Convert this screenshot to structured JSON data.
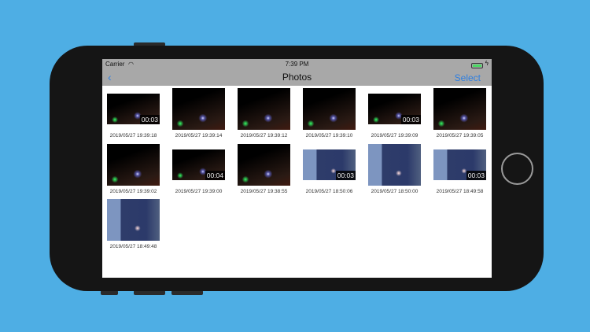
{
  "status_bar": {
    "carrier": "Carrier",
    "time": "7:39 PM"
  },
  "nav": {
    "title": "Photos",
    "select_label": "Select",
    "back_label": "‹"
  },
  "items": [
    {
      "date": "2019/05/27 19:39:18",
      "duration": "00:03",
      "kind": "video",
      "tone": "night"
    },
    {
      "date": "2019/05/27 19:39:14",
      "duration": null,
      "kind": "photo",
      "tone": "night"
    },
    {
      "date": "2019/05/27 19:39:12",
      "duration": null,
      "kind": "photo",
      "tone": "night"
    },
    {
      "date": "2019/05/27 19:39:10",
      "duration": null,
      "kind": "photo",
      "tone": "night"
    },
    {
      "date": "2019/05/27 19:39:09",
      "duration": "00:03",
      "kind": "video",
      "tone": "night"
    },
    {
      "date": "2019/05/27 19:39:05",
      "duration": null,
      "kind": "photo",
      "tone": "night"
    },
    {
      "date": "2019/05/27 19:39:02",
      "duration": null,
      "kind": "photo",
      "tone": "night"
    },
    {
      "date": "2019/05/27 19:39:00",
      "duration": "00:04",
      "kind": "video",
      "tone": "night"
    },
    {
      "date": "2019/05/27 19:38:55",
      "duration": null,
      "kind": "photo",
      "tone": "night"
    },
    {
      "date": "2019/05/27 18:50:06",
      "duration": "00:03",
      "kind": "video",
      "tone": "day"
    },
    {
      "date": "2019/05/27 18:50:00",
      "duration": null,
      "kind": "photo",
      "tone": "day"
    },
    {
      "date": "2019/05/27 18:49:58",
      "duration": "00:03",
      "kind": "video",
      "tone": "day"
    },
    {
      "date": "2019/05/27 18:49:48",
      "duration": null,
      "kind": "photo",
      "tone": "day"
    }
  ],
  "colors": {
    "background": "#4eaee4",
    "accent": "#2f7fe0",
    "nav_bar": "#a8a8a8"
  }
}
